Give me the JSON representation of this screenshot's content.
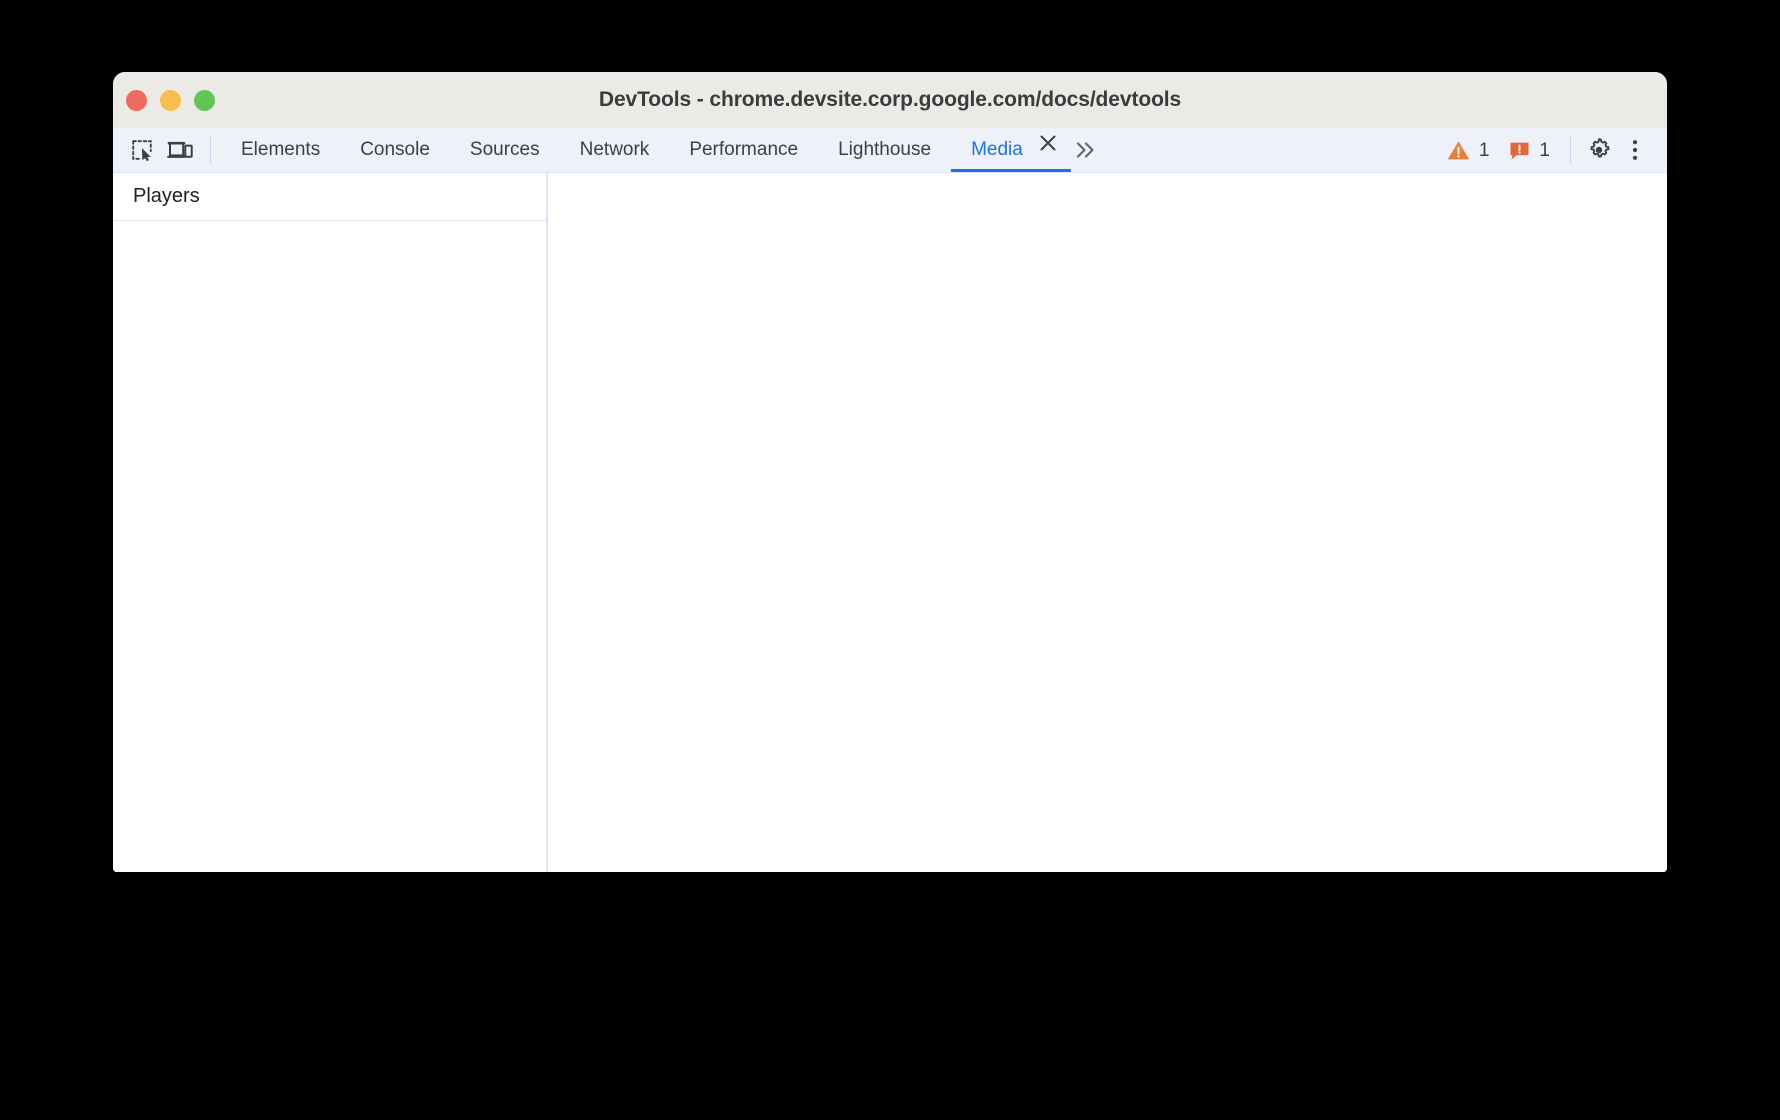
{
  "window": {
    "title": "DevTools - chrome.devsite.corp.google.com/docs/devtools",
    "traffic_lights": {
      "close": "close-window",
      "minimize": "minimize-window",
      "maximize": "maximize-window"
    },
    "colors": {
      "titlebar_bg": "#eceae7",
      "tabbar_bg": "#eef1f9",
      "accent": "#1a73e8",
      "warning": "#e87f3a",
      "issue": "#e2683c",
      "text": "#3c4043",
      "divider": "#dfe5f5"
    }
  },
  "toolbar": {
    "inspect_icon": "inspect-element-icon",
    "device_toolbar_icon": "device-toolbar-icon",
    "settings_icon": "gear-icon",
    "more_options_icon": "three-dot-vertical-icon",
    "more_tabs_icon": "chevron-double-right-icon",
    "close_tab_icon": "close-icon"
  },
  "tabs": [
    {
      "label": "Elements",
      "active": false
    },
    {
      "label": "Console",
      "active": false
    },
    {
      "label": "Sources",
      "active": false
    },
    {
      "label": "Network",
      "active": false
    },
    {
      "label": "Performance",
      "active": false
    },
    {
      "label": "Lighthouse",
      "active": false
    },
    {
      "label": "Media",
      "active": true
    }
  ],
  "status_counters": {
    "warnings": {
      "icon": "warning-triangle-icon",
      "count": "1"
    },
    "issues": {
      "icon": "issue-message-icon",
      "count": "1"
    }
  },
  "media_panel": {
    "sidebar": {
      "header": "Players",
      "items": []
    },
    "detail": {
      "content": ""
    }
  }
}
